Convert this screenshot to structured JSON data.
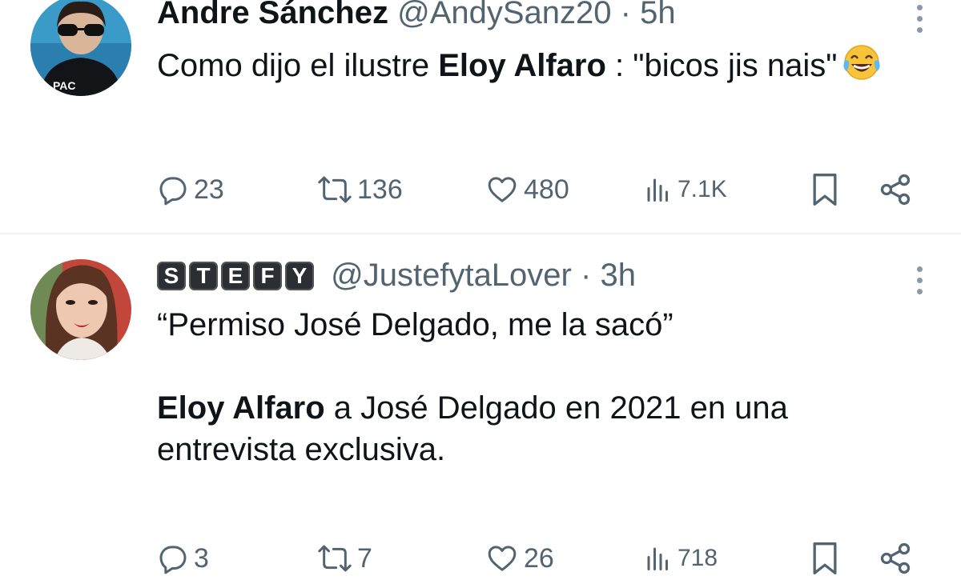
{
  "tweets": [
    {
      "display_name": "Andre Sánchez",
      "handle": "@AndySanz20",
      "separator": "·",
      "time": "5h",
      "text_parts": [
        "Como dijo el ilustre ",
        "Eloy Alfaro",
        " : \"bicos jis nais\""
      ],
      "emoji": "face-with-tears-of-joy",
      "stats": {
        "replies": "23",
        "retweets": "136",
        "likes": "480",
        "views": "7.1K"
      }
    },
    {
      "name_badges": [
        "S",
        "T",
        "E",
        "F",
        "Y"
      ],
      "handle": "@JustefytaLover",
      "separator": "·",
      "time": "3h",
      "line1": "“Permiso José Delgado, me la sacó”",
      "text_parts": [
        "Eloy Alfaro",
        " a José Delgado en 2021 en una entrevista exclusiva."
      ],
      "stats": {
        "replies": "3",
        "retweets": "7",
        "likes": "26",
        "views": "718"
      }
    }
  ],
  "icons": [
    "reply-icon",
    "retweet-icon",
    "like-icon",
    "views-icon",
    "bookmark-icon",
    "share-icon",
    "more-icon"
  ],
  "colors": {
    "text": "#0f1419",
    "muted": "#536471",
    "divider": "#eff3f4",
    "background": "#ffffff"
  }
}
